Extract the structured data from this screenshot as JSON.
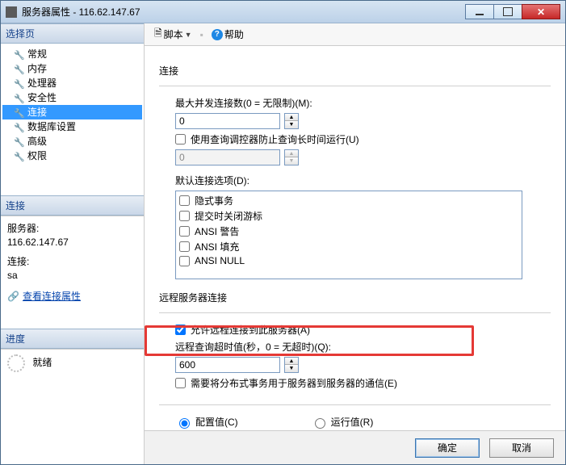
{
  "window": {
    "title": "服务器属性 - 116.62.147.67"
  },
  "toolbar": {
    "script": "脚本",
    "help": "帮助"
  },
  "sidebar": {
    "header_select": "选择页",
    "items": [
      {
        "label": "常规"
      },
      {
        "label": "内存"
      },
      {
        "label": "处理器"
      },
      {
        "label": "安全性"
      },
      {
        "label": "连接"
      },
      {
        "label": "数据库设置"
      },
      {
        "label": "高级"
      },
      {
        "label": "权限"
      }
    ],
    "selected_index": 4,
    "header_conn": "连接",
    "server_label": "服务器:",
    "server_value": "116.62.147.67",
    "conn_label": "连接:",
    "conn_value": "sa",
    "view_props": "查看连接属性",
    "header_progress": "进度",
    "progress_status": "就绪"
  },
  "form": {
    "grp_conn": "连接",
    "max_conn_label": "最大并发连接数(0 = 无限制)(M):",
    "max_conn_value": "0",
    "use_governor": "使用查询调控器防止查询长时间运行(U)",
    "governor_value": "0",
    "default_opts_label": "默认连接选项(D):",
    "list": [
      "隐式事务",
      "提交时关闭游标",
      "ANSI 警告",
      "ANSI 填充",
      "ANSI NULL"
    ],
    "grp_remote": "远程服务器连接",
    "allow_remote": "允许远程连接到此服务器(A)",
    "remote_timeout_label": "远程查询超时值(秒，0 = 无超时)(Q):",
    "remote_timeout_value": "600",
    "need_dtc": "需要将分布式事务用于服务器到服务器的通信(E)",
    "radio_config": "配置值(C)",
    "radio_run": "运行值(R)"
  },
  "footer": {
    "ok": "确定",
    "cancel": "取消"
  }
}
